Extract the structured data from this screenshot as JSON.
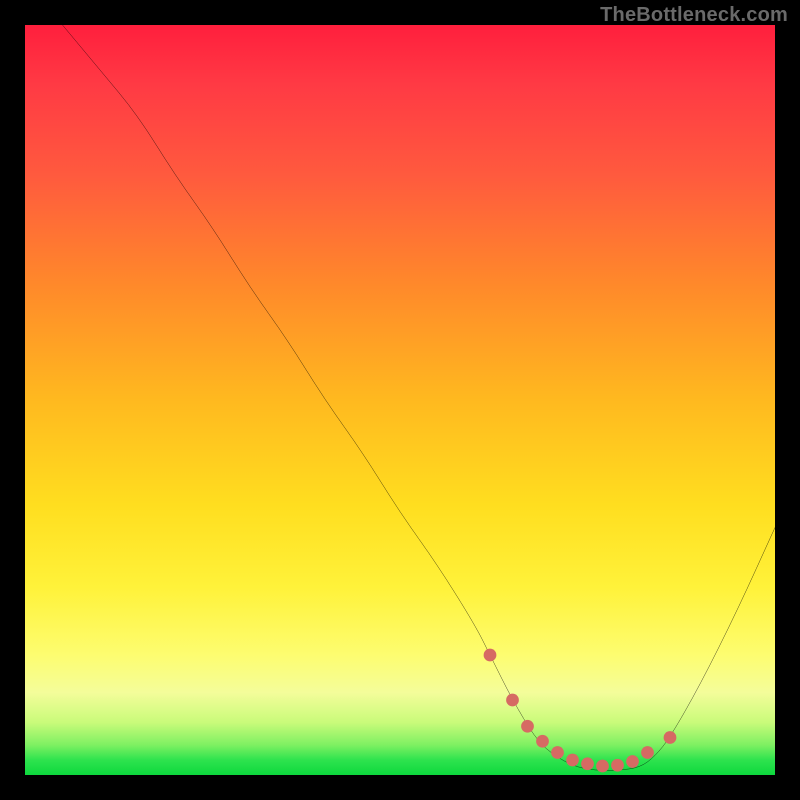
{
  "watermark": "TheBottleneck.com",
  "chart_data": {
    "type": "line",
    "title": "",
    "xlabel": "",
    "ylabel": "",
    "xlim": [
      0,
      100
    ],
    "ylim": [
      0,
      100
    ],
    "grid": false,
    "legend": false,
    "series": [
      {
        "name": "bottleneck-curve",
        "x": [
          5,
          10,
          15,
          20,
          25,
          30,
          35,
          40,
          45,
          50,
          55,
          60,
          62,
          65,
          68,
          70,
          73,
          76,
          79,
          82,
          84,
          86,
          90,
          95,
          100
        ],
        "y": [
          100,
          94,
          88,
          80,
          73,
          65,
          58,
          50,
          43,
          35,
          28,
          20,
          16,
          10,
          5,
          3,
          1.2,
          0.6,
          0.6,
          1.0,
          2.5,
          5,
          12,
          22,
          33
        ]
      }
    ],
    "markers": {
      "name": "minimum-band",
      "color": "#d66a63",
      "x": [
        62,
        65,
        67,
        69,
        71,
        73,
        75,
        77,
        79,
        81,
        83,
        86
      ],
      "y": [
        16,
        10,
        6.5,
        4.5,
        3,
        2,
        1.5,
        1.2,
        1.3,
        1.8,
        3,
        5
      ]
    },
    "gradient_stops": [
      {
        "pos": 0,
        "color": "#ff1f3d"
      },
      {
        "pos": 8,
        "color": "#ff3a44"
      },
      {
        "pos": 20,
        "color": "#ff5a3e"
      },
      {
        "pos": 35,
        "color": "#ff8a2a"
      },
      {
        "pos": 50,
        "color": "#ffb91f"
      },
      {
        "pos": 64,
        "color": "#ffde1f"
      },
      {
        "pos": 75,
        "color": "#fff23a"
      },
      {
        "pos": 84,
        "color": "#fdfd70"
      },
      {
        "pos": 89,
        "color": "#f4fd9a"
      },
      {
        "pos": 93,
        "color": "#c9fb7a"
      },
      {
        "pos": 96,
        "color": "#7ef062"
      },
      {
        "pos": 98,
        "color": "#2ee34e"
      },
      {
        "pos": 100,
        "color": "#0dd83d"
      }
    ]
  }
}
